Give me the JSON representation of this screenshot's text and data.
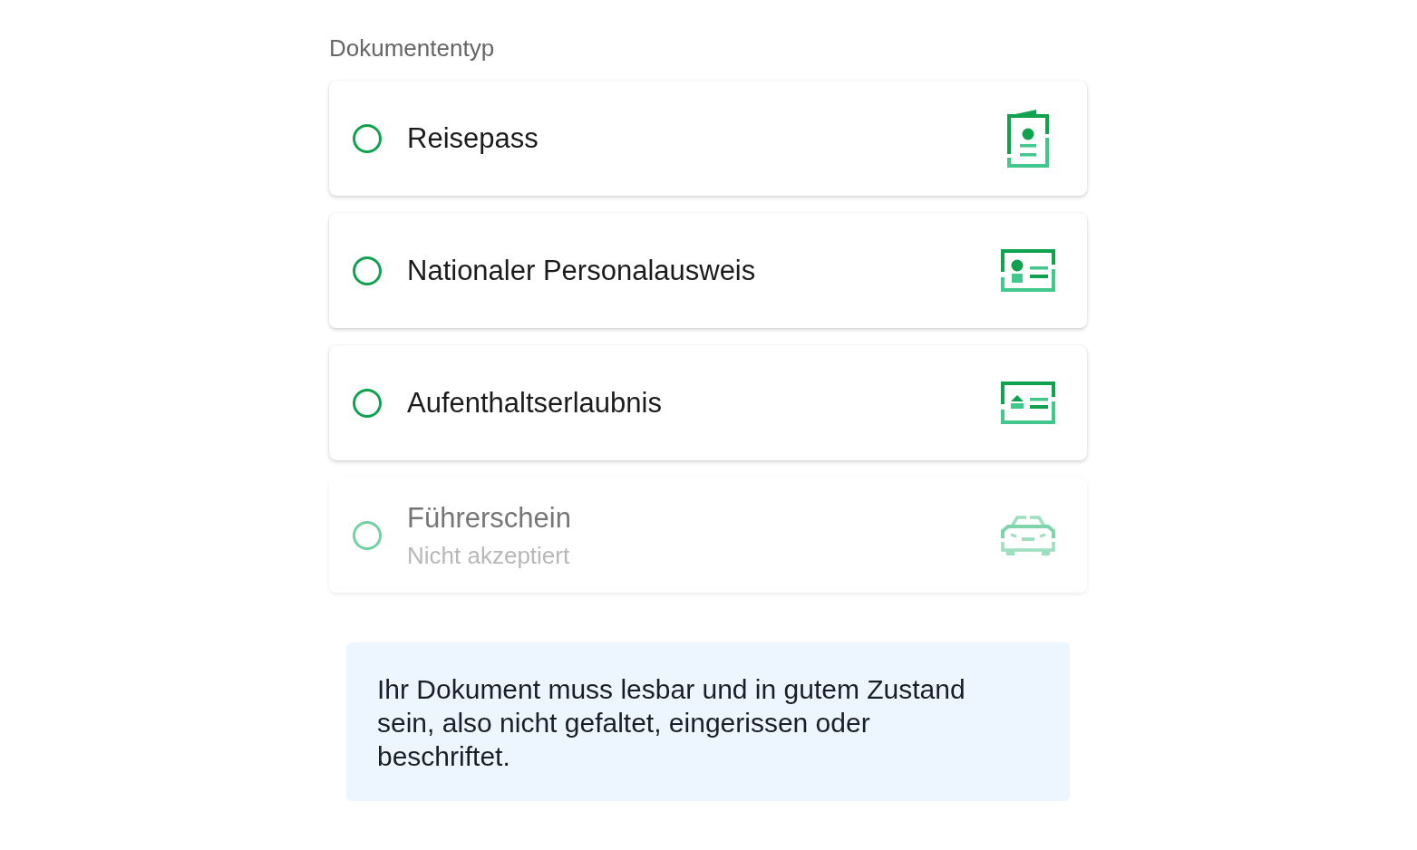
{
  "section_label": "Dokumententyp",
  "options": [
    {
      "kind": "passport",
      "label": "Reisepass",
      "selected": false,
      "disabled": false
    },
    {
      "kind": "idcard",
      "label": "Nationaler Personalausweis",
      "selected": false,
      "disabled": false
    },
    {
      "kind": "permit",
      "label": "Aufenthaltserlaubnis",
      "selected": false,
      "disabled": false
    },
    {
      "kind": "licence",
      "label": "Führerschein",
      "note": "Nicht akzeptiert",
      "selected": false,
      "disabled": true
    }
  ],
  "info_box": {
    "text": "Ihr Dokument muss lesbar und in gutem Zustand sein, also nicht gefaltet, eingerissen oder beschriftet."
  }
}
